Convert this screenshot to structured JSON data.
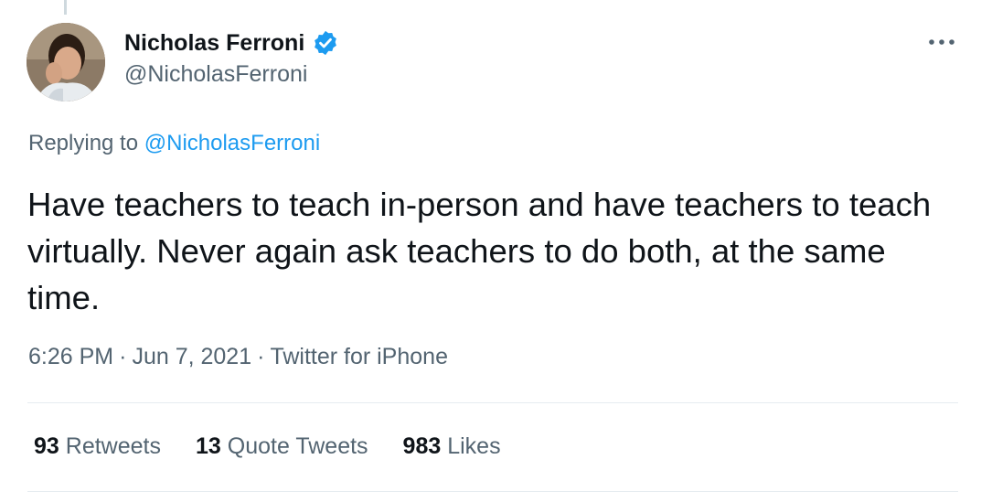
{
  "tweet": {
    "author": {
      "display_name": "Nicholas Ferroni",
      "handle": "@NicholasFerroni",
      "verified": true,
      "verified_color": "#1d9bf0"
    },
    "replying_prefix": "Replying to",
    "replying_to": "@NicholasFerroni",
    "text": "Have teachers to teach in-person and have teachers to teach virtually. Never again ask teachers to do both, at the same time.",
    "time": "6:26 PM",
    "date": "Jun 7, 2021",
    "source": "Twitter for iPhone",
    "separator": "·",
    "more_icon": "more-horizontal-icon"
  },
  "stats": {
    "retweets": {
      "count": "93",
      "label": "Retweets"
    },
    "quote_tweets": {
      "count": "13",
      "label": "Quote Tweets"
    },
    "likes": {
      "count": "983",
      "label": "Likes"
    }
  },
  "colors": {
    "text_primary": "#0f1419",
    "text_secondary": "#536471",
    "link": "#1d9bf0",
    "divider": "#e6ecf0"
  }
}
